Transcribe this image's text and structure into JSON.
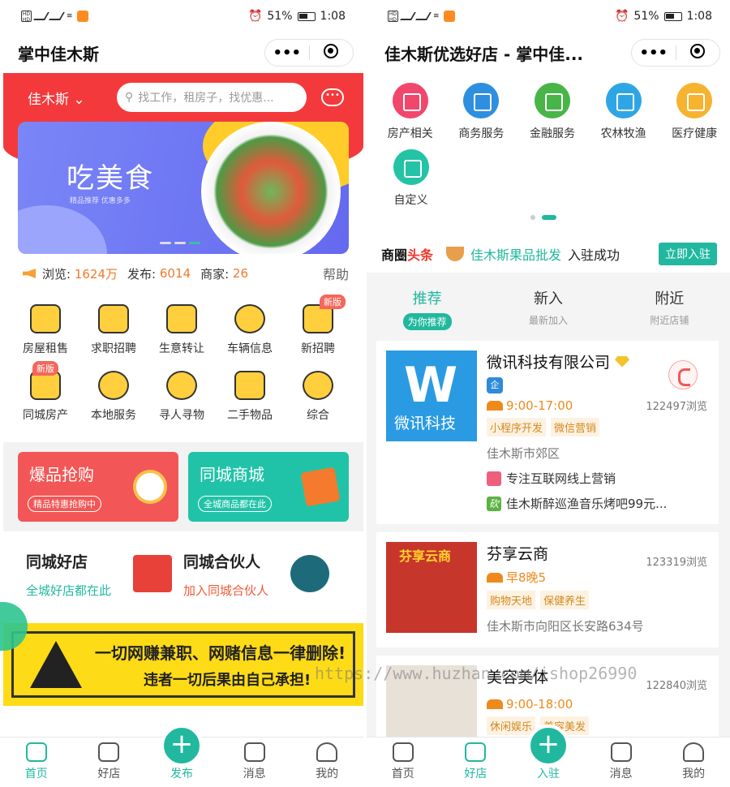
{
  "status": {
    "battery": "51%",
    "time": "1:08"
  },
  "left": {
    "nav_title": "掌中佳木斯",
    "city": "佳木斯",
    "search_placeholder": "找工作，租房子，找优惠...",
    "banner_title": "吃美食",
    "banner_sub": "精品推荐  优惠多多",
    "stats": {
      "views_label": "浏览:",
      "views": "1624万",
      "posts_label": "发布:",
      "posts": "6014",
      "merchants_label": "商家:",
      "merchants": "26",
      "help": "帮助"
    },
    "grid": [
      {
        "label": "房屋租售",
        "icon": "building-icon"
      },
      {
        "label": "求职招聘",
        "icon": "briefcase-icon"
      },
      {
        "label": "生意转让",
        "icon": "bag-icon"
      },
      {
        "label": "车辆信息",
        "icon": "car-icon"
      },
      {
        "label": "新招聘",
        "icon": "id-card-icon",
        "badge": "新版"
      },
      {
        "label": "同城房产",
        "icon": "house-icon",
        "badge": "新版"
      },
      {
        "label": "本地服务",
        "icon": "location-pin-icon"
      },
      {
        "label": "寻人寻物",
        "icon": "magnifier-icon"
      },
      {
        "label": "二手物品",
        "icon": "camera-icon"
      },
      {
        "label": "综合",
        "icon": "atom-icon"
      }
    ],
    "promo": [
      {
        "title": "爆品抢购",
        "sub": "精品特惠抢购中"
      },
      {
        "title": "同城商城",
        "sub": "全城商品都在此"
      }
    ],
    "shops": [
      {
        "title": "同城好店",
        "sub": "全城好店都在此"
      },
      {
        "title": "同城合伙人",
        "sub": "加入同城合伙人"
      }
    ],
    "warning": {
      "line1": "一切网赚兼职、网赌信息一律删除!",
      "line2": "违者一切后果由自己承担!"
    },
    "tabs": [
      {
        "label": "首页",
        "icon": "home-icon"
      },
      {
        "label": "好店",
        "icon": "shop-icon"
      },
      {
        "label": "发布",
        "icon": "plus-icon"
      },
      {
        "label": "消息",
        "icon": "message-icon"
      },
      {
        "label": "我的",
        "icon": "user-icon"
      }
    ]
  },
  "right": {
    "nav_title": "佳木斯优选好店 - 掌中佳...",
    "cats": [
      {
        "label": "房产相关",
        "color": "#f2476d"
      },
      {
        "label": "商务服务",
        "color": "#2e8fe0"
      },
      {
        "label": "金融服务",
        "color": "#49b548"
      },
      {
        "label": "农林牧渔",
        "color": "#2ea6e6"
      },
      {
        "label": "医疗健康",
        "color": "#f5b330"
      },
      {
        "label": "自定义",
        "color": "#23c3a6"
      }
    ],
    "headline": {
      "k1": "商圈",
      "k2": "头条",
      "name": "佳木斯果品批发",
      "msg": "入驻成功",
      "btn": "立即入驻"
    },
    "subtabs": [
      {
        "title": "推荐",
        "sub": "为你推荐"
      },
      {
        "title": "新入",
        "sub": "最新加入"
      },
      {
        "title": "附近",
        "sub": "附近店铺"
      }
    ],
    "cards": [
      {
        "name": "微讯科技有限公司",
        "logo_text": "微讯科技",
        "verified": "企",
        "hours": "9:00-17:00",
        "tags": [
          "小程序开发",
          "微信营销"
        ],
        "views": "122497浏览",
        "addr": "佳木斯市郊区",
        "line1": "专注互联网线上营销",
        "line2": "佳木斯醉巡渔音乐烤吧99元...",
        "line2_badge": "砍"
      },
      {
        "name": "芬享云商",
        "logo_text": "芬享云商",
        "hours": "早8晚5",
        "tags": [
          "购物天地",
          "保健养生"
        ],
        "views": "123319浏览",
        "addr": "佳木斯市向阳区长安路634号"
      },
      {
        "name": "美容美体",
        "hours": "9:00-18:00",
        "tags": [
          "休闲娱乐",
          "美容美发"
        ],
        "views": "122840浏览"
      }
    ],
    "tabs": [
      {
        "label": "首页",
        "icon": "home-icon"
      },
      {
        "label": "好店",
        "icon": "shop-icon"
      },
      {
        "label": "入驻",
        "icon": "plus-icon"
      },
      {
        "label": "消息",
        "icon": "message-icon"
      },
      {
        "label": "我的",
        "icon": "user-icon"
      }
    ]
  },
  "watermark": "https://www.huzhan.com/ishop26990"
}
